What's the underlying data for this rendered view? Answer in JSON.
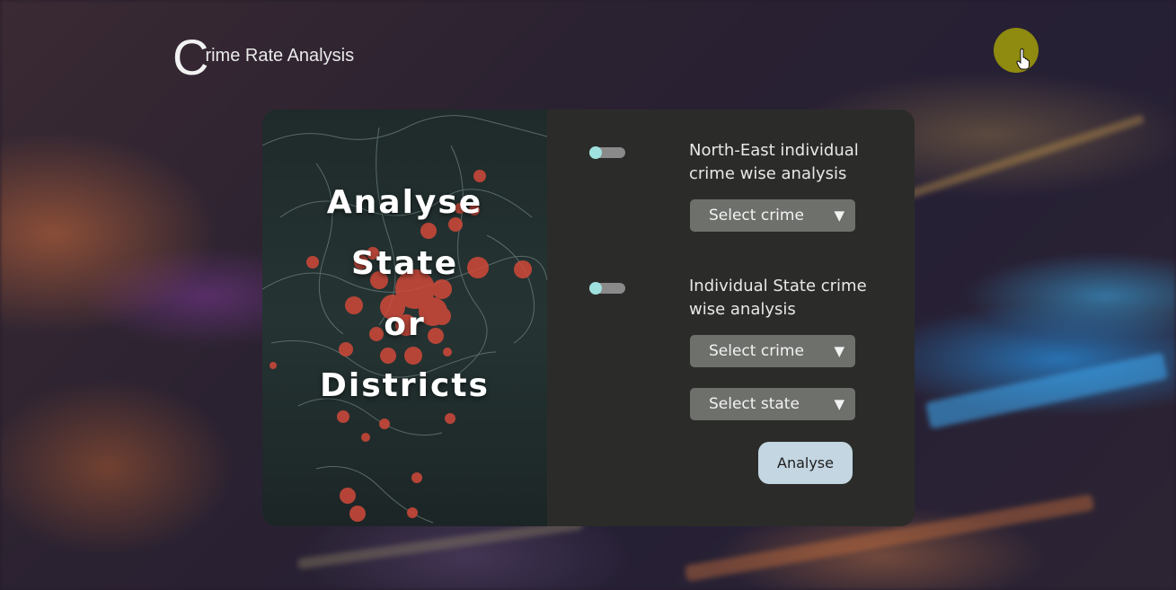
{
  "header": {
    "logo_initial": "C",
    "logo_rest": "rime Rate Analysis"
  },
  "hero": {
    "lines": [
      "Analyse",
      "State",
      "or",
      "Districts"
    ]
  },
  "options": [
    {
      "label": "North-East individual crime wise analysis",
      "toggle_on": false,
      "selects": [
        {
          "value": "Select crime"
        }
      ]
    },
    {
      "label": "Individual State crime wise analysis",
      "toggle_on": false,
      "selects": [
        {
          "value": "Select crime"
        },
        {
          "value": "Select state"
        }
      ]
    }
  ],
  "analyse_label": "Analyse",
  "colors": {
    "avatar": "#8f8a10",
    "toggle_knob": "#9fe1df",
    "button": "#c3d6e1",
    "select_bg": "#6e706c",
    "panel_bg": "#2b2c2a"
  },
  "icons": {
    "dropdown": "▼"
  }
}
